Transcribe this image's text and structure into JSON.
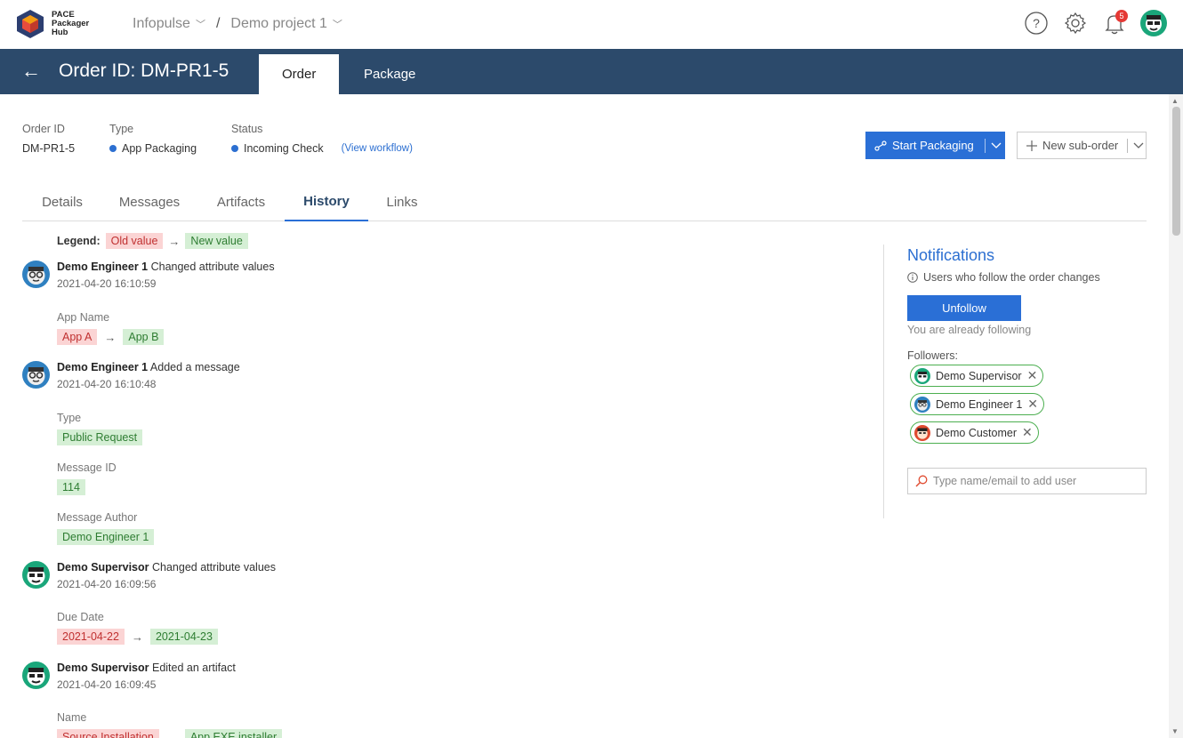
{
  "app": {
    "logo_text": "PACE\nPackager\nHub"
  },
  "breadcrumb": {
    "org": "Infopulse",
    "project": "Demo project 1",
    "separator": "/"
  },
  "notifications_count": "5",
  "header": {
    "back": "←",
    "title": "Order ID: DM-PR1-5",
    "tabs": [
      {
        "label": "Order"
      },
      {
        "label": "Package"
      }
    ]
  },
  "meta": {
    "order_id_label": "Order ID",
    "order_id_value": "DM-PR1-5",
    "type_label": "Type",
    "type_value": "App Packaging",
    "status_label": "Status",
    "status_value": "Incoming Check",
    "workflow_link": "(View workflow)"
  },
  "actions": {
    "start_packaging": "Start Packaging",
    "new_suborder": "New sub-order"
  },
  "tabs": [
    {
      "label": "Details"
    },
    {
      "label": "Messages"
    },
    {
      "label": "Artifacts"
    },
    {
      "label": "History"
    },
    {
      "label": "Links"
    }
  ],
  "legend": {
    "label": "Legend:",
    "old": "Old value",
    "new": "New value"
  },
  "events": [
    {
      "user": "Demo Engineer 1",
      "action": " Changed attribute values",
      "time": "2021-04-20 16:10:59",
      "fields": [
        {
          "label": "App Name",
          "old": "App A",
          "new": "App B"
        }
      ]
    },
    {
      "user": "Demo Engineer 1",
      "action": " Added a message",
      "time": "2021-04-20 16:10:48",
      "fields": [
        {
          "label": "Type",
          "new": "Public Request"
        },
        {
          "label": "Message ID",
          "new": "114"
        },
        {
          "label": "Message Author",
          "new": "Demo Engineer 1"
        }
      ]
    },
    {
      "user": "Demo Supervisor",
      "action": " Changed attribute values",
      "time": "2021-04-20 16:09:56",
      "fields": [
        {
          "label": "Due Date",
          "old": "2021-04-22",
          "new": "2021-04-23"
        }
      ]
    },
    {
      "user": "Demo Supervisor",
      "action": " Edited an artifact",
      "time": "2021-04-20 16:09:45",
      "fields": [
        {
          "label": "Name",
          "old": "Source Installation",
          "new": "App EXE installer"
        }
      ]
    }
  ],
  "notifications": {
    "title": "Notifications",
    "info": "Users who follow the order changes",
    "unfollow": "Unfollow",
    "following": "You are already following",
    "followers_label": "Followers:",
    "followers": [
      {
        "name": "Demo Supervisor"
      },
      {
        "name": "Demo Engineer 1"
      },
      {
        "name": "Demo Customer"
      }
    ],
    "add_placeholder": "Type name/email to add user"
  },
  "icons": {
    "help": "help-icon",
    "settings": "gear-icon",
    "bell": "bell-icon",
    "search": "search-icon"
  },
  "colors": {
    "primary": "#2a6fd6",
    "header": "#2c4a6b",
    "old_bg": "#fbd4d4",
    "new_bg": "#d5efd5"
  }
}
